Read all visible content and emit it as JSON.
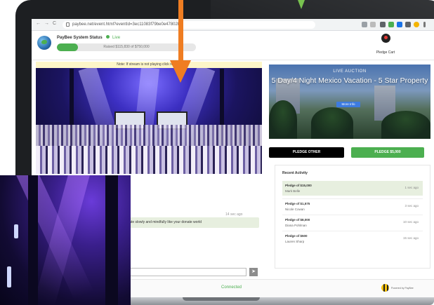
{
  "browser": {
    "url": "paybee.net/event.html?eventId=3ec11083f79be0e47802b3",
    "nav_back": "←",
    "nav_forward": "→",
    "nav_reload": "C"
  },
  "header": {
    "system_status": "PayBee System Status",
    "live_label": "Live",
    "progress_label": "Raised $115,830 of $750,000",
    "progress_fraction": 0.154,
    "cart_label": "Pledge Cart"
  },
  "stream": {
    "note": "Note: If stream is not playing click refresh"
  },
  "chat": {
    "time": "14 sec ago",
    "message": "Donate slowly and mindfully like your donate world",
    "input_placeholder": "",
    "send_icon": "send-icon"
  },
  "auction": {
    "live_label": "LIVE AUCTION",
    "title": "5 Day/4 Night Mexico Vacation - 5 Star Property",
    "more_info": "More Info",
    "slides": 3,
    "active_slide": 1
  },
  "buttons": {
    "pledge_other": "PLEDGE OTHER",
    "pledge_now": "PLEDGE $5,000"
  },
  "activity": {
    "title": "Recent Activity",
    "rows": [
      {
        "pledge": "Pledge of $15,000",
        "name": "Mark Belle",
        "time": "1 sec ago"
      },
      {
        "pledge": "Pledge of $1,575",
        "name": "Nicole Cowan",
        "time": "3 sec ago"
      },
      {
        "pledge": "Pledge of $8,000",
        "name": "Diana Pohlman",
        "time": "10 sec ago"
      },
      {
        "pledge": "Pledge of $500",
        "name": "Lauren Sharp",
        "time": "15 sec ago"
      }
    ]
  },
  "footer": {
    "status": "Connected",
    "powered_by": "Powered by PayBee"
  },
  "colors": {
    "accent_green": "#4caf50",
    "arrow_orange": "#ef7d22"
  }
}
